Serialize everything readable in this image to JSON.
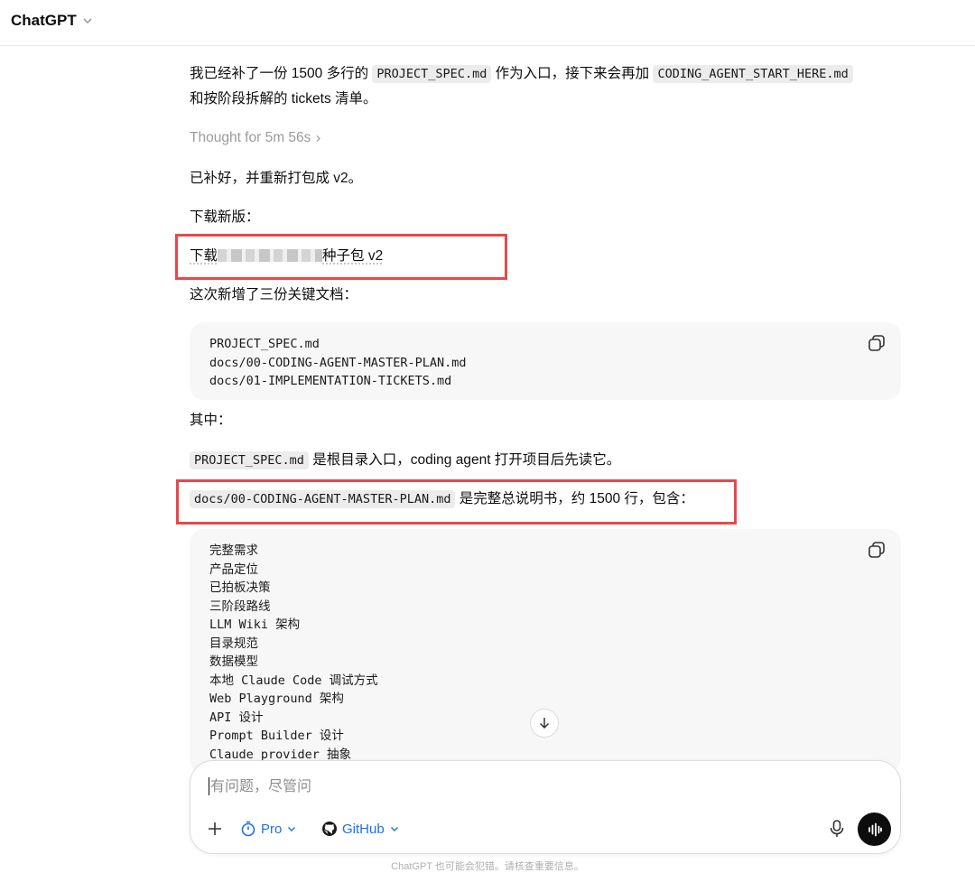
{
  "header": {
    "model_name": "ChatGPT"
  },
  "messages": {
    "intro_line1_pre": "我已经补了一份 1500 多行的 ",
    "intro_line1_code1": "PROJECT_SPEC.md",
    "intro_line1_mid": " 作为入口，接下来会再加 ",
    "intro_line1_code2": "CODING_AGENT_START_HERE.md",
    "intro_line2": "和按阶段拆解的 tickets 清单。",
    "thought": "Thought for 5m 56s",
    "done": "已补好，并重新打包成 v2。",
    "download_heading": "下载新版：",
    "download_link_pre": "下载",
    "download_link_post": "种子包 v2",
    "new_docs_heading": "这次新增了三份关键文档：",
    "among": "其中：",
    "spec_code": "PROJECT_SPEC.md",
    "spec_text": " 是根目录入口，coding agent 打开项目后先读它。",
    "plan_code": "docs/00-CODING-AGENT-MASTER-PLAN.md",
    "plan_text": " 是完整总说明书，约 1500 行，包含："
  },
  "code_block_1": {
    "lines": [
      "PROJECT_SPEC.md",
      "docs/00-CODING-AGENT-MASTER-PLAN.md",
      "docs/01-IMPLEMENTATION-TICKETS.md"
    ]
  },
  "code_block_2": {
    "lines": [
      "完整需求",
      "产品定位",
      "已拍板决策",
      "三阶段路线",
      "LLM Wiki 架构",
      "目录规范",
      "数据模型",
      "本地 Claude Code 调试方式",
      "Web Playground 架构",
      "API 设计",
      "Prompt Builder 设计",
      "Claude provider 抽象"
    ]
  },
  "composer": {
    "placeholder": "有问题，尽管问",
    "pro_label": "Pro",
    "github_label": "GitHub"
  },
  "footer": {
    "disclaimer": "ChatGPT 也可能会犯错。请核查重要信息。"
  },
  "colors": {
    "highlight_border": "#e5484d",
    "accent": "#1f6feb"
  }
}
